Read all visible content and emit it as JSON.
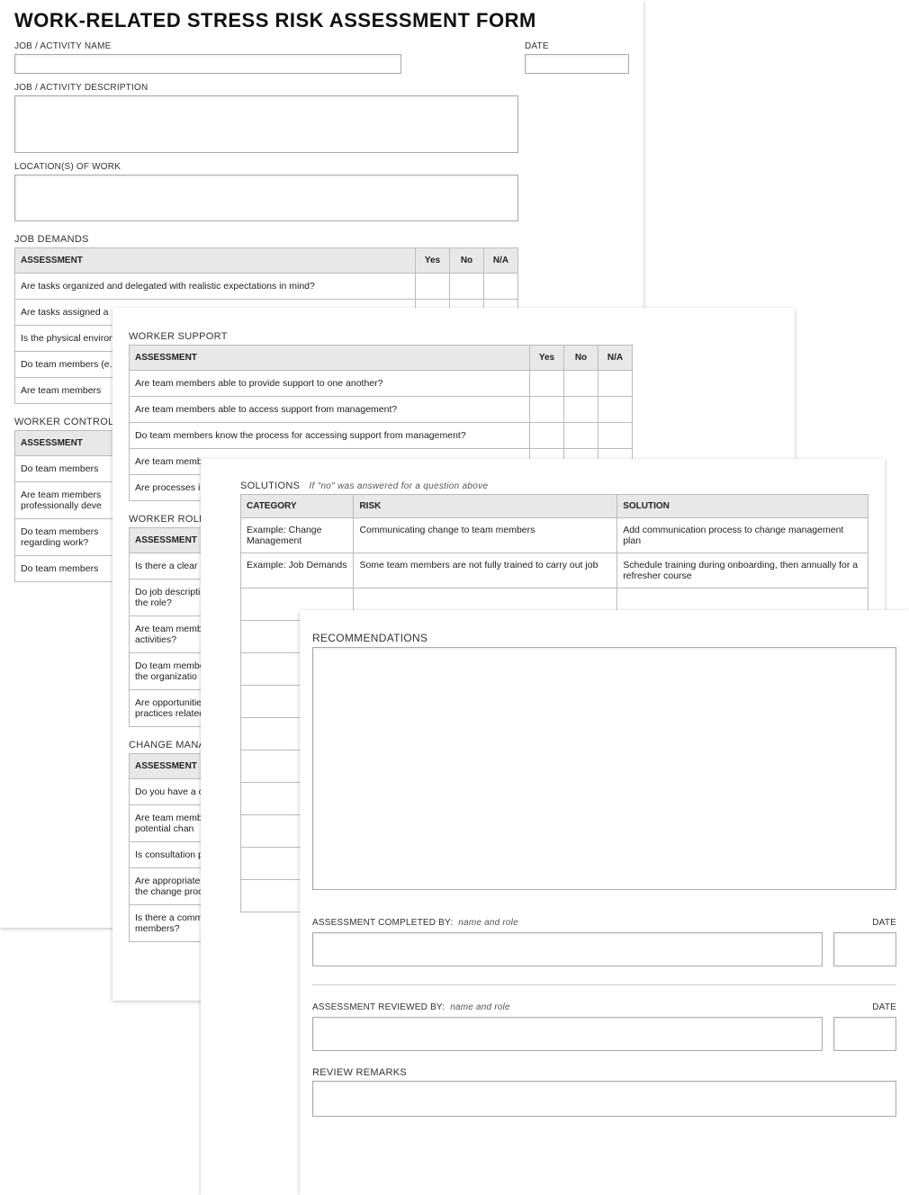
{
  "header": {
    "title": "WORK-RELATED STRESS RISK ASSESSMENT FORM"
  },
  "fields": {
    "job_name_label": "JOB / ACTIVITY NAME",
    "date_label": "DATE",
    "desc_label": "JOB / ACTIVITY DESCRIPTION",
    "loc_label": "LOCATION(S) OF WORK"
  },
  "cols": {
    "assessment": "ASSESSMENT",
    "yes": "Yes",
    "no": "No",
    "na": "N/A"
  },
  "sections": {
    "job_demands": {
      "title": "JOB DEMANDS",
      "rows": [
        "Are tasks organized and delegated with realistic expectations in mind?",
        "Are tasks assigned a",
        "Is the physical environment (e.g. comfortable, s",
        "Do team members (e.g. equipment, tra",
        "Are team members"
      ]
    },
    "worker_control": {
      "title": "WORKER CONTROL",
      "rows": [
        "Do team members",
        "Are team members professionally deve",
        "Do team members regarding work?",
        "Do team members"
      ]
    },
    "worker_support": {
      "title": "WORKER SUPPORT",
      "rows": [
        "Are team members able to provide support to one another?",
        "Are team members able to access support from management?",
        "Do team members know the process for accessing support from management?",
        "Are team membe",
        "Are processes in p related issues?"
      ]
    },
    "worker_role": {
      "title": "WORKER ROLE",
      "rows": [
        "Is there a clear or",
        "Do job description the role?",
        "Are team membe activities?",
        "Do team membe of the organizatio",
        "Are opportunities practices related"
      ]
    },
    "change_mgmt": {
      "title": "CHANGE MANAG",
      "rows": [
        "Do you have a ch",
        "Are team membe to potential chan",
        "Is consultation pro",
        "Are appropriate p the change proce",
        "Is there a commu members?"
      ]
    }
  },
  "solutions": {
    "title": "SOLUTIONS",
    "note": "If \"no\" was answered for a question above",
    "headers": {
      "category": "CATEGORY",
      "risk": "RISK",
      "solution": "SOLUTION"
    },
    "rows": [
      {
        "category": "Example: Change Management",
        "risk": "Communicating change to team members",
        "solution": "Add communication process to change management plan"
      },
      {
        "category": "Example: Job Demands",
        "risk": "Some team members are not fully trained to carry out job",
        "solution": "Schedule training during onboarding, then annually for a refresher course"
      }
    ],
    "empty_rows": 10
  },
  "page4": {
    "rec_title": "RECOMMENDATIONS",
    "completed_label": "ASSESSMENT COMPLETED BY:",
    "reviewed_label": "ASSESSMENT REVIEWED BY:",
    "name_hint": "name and role",
    "date_label": "DATE",
    "remarks_title": "REVIEW REMARKS"
  }
}
